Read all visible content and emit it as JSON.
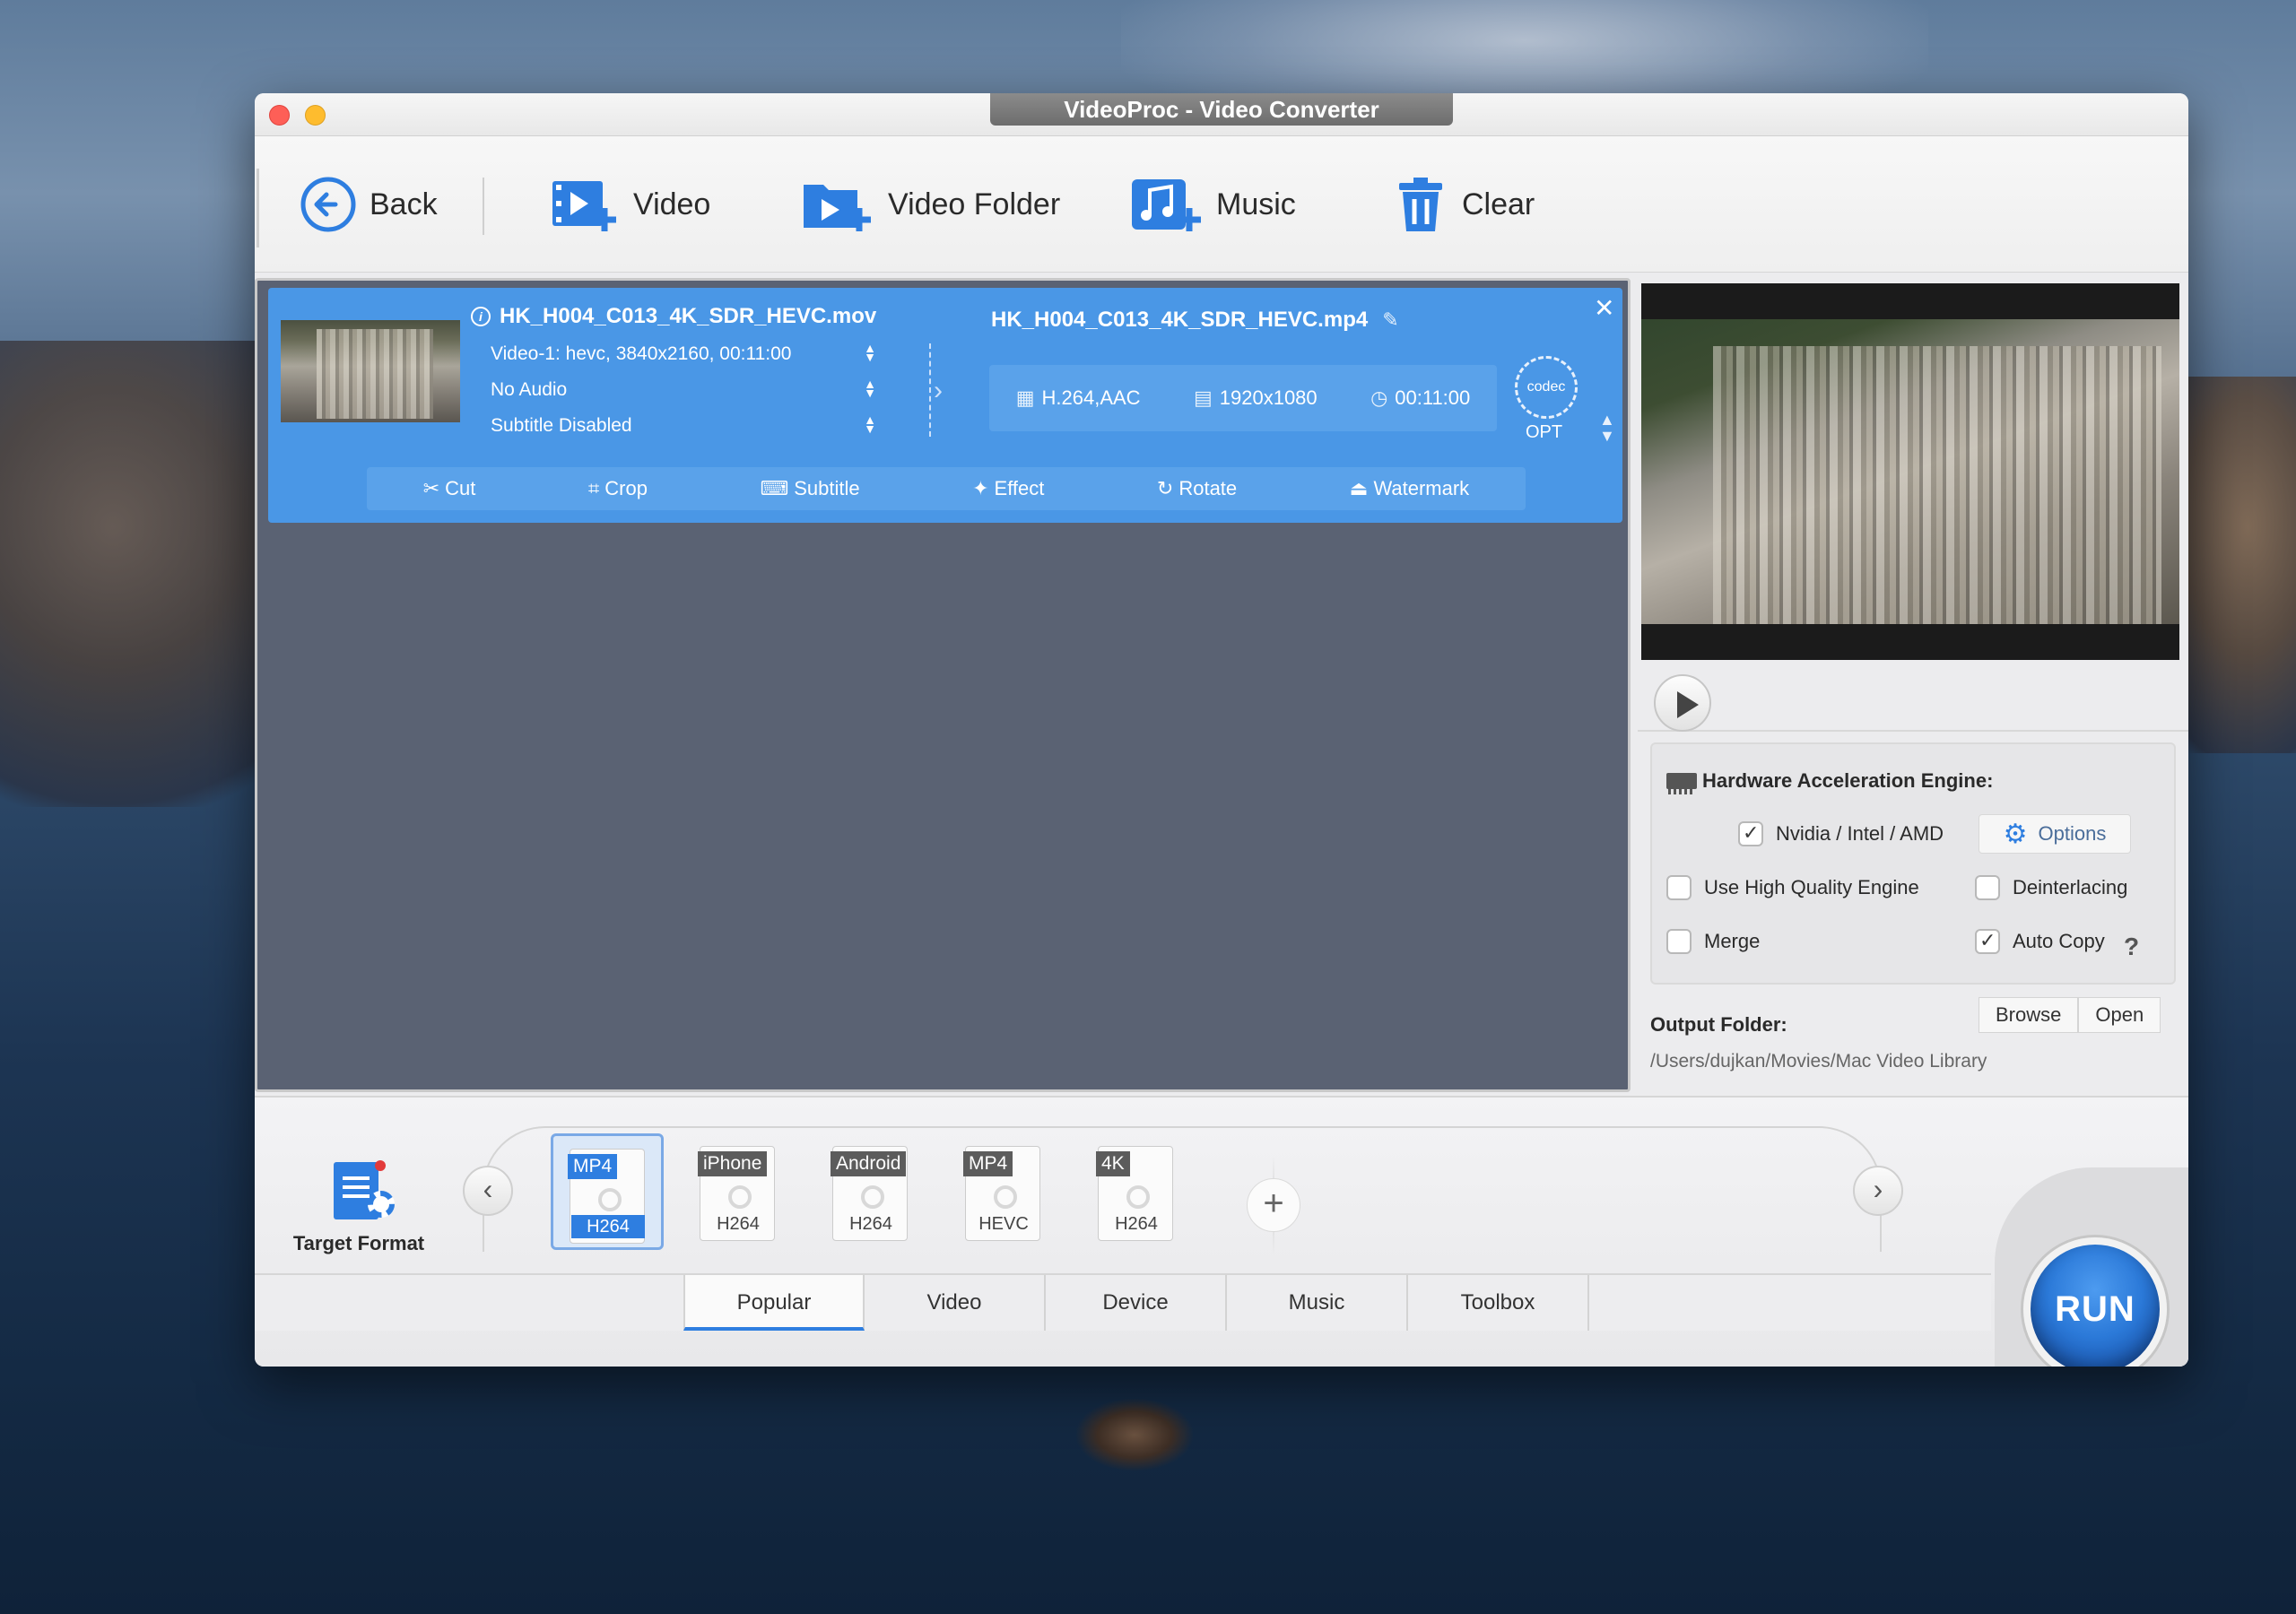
{
  "window": {
    "title": "VideoProc - Video Converter"
  },
  "toolbar": {
    "back": "Back",
    "video": "Video",
    "video_folder": "Video Folder",
    "music": "Music",
    "clear": "Clear"
  },
  "file": {
    "source_name": "HK_H004_C013_4K_SDR_HEVC.mov",
    "video_track": "Video-1: hevc, 3840x2160, 00:11:00",
    "audio_track": "No Audio",
    "subtitle_track": "Subtitle Disabled",
    "output_name": "HK_H004_C013_4K_SDR_HEVC.mp4",
    "output_codec": "H.264,AAC",
    "output_resolution": "1920x1080",
    "output_duration": "00:11:00",
    "codec_label": "codec",
    "opt_label": "OPT"
  },
  "edit_tools": [
    "Cut",
    "Crop",
    "Subtitle",
    "Effect",
    "Rotate",
    "Watermark"
  ],
  "hardware": {
    "title": "Hardware Acceleration Engine:",
    "nvidia": {
      "label": "Nvidia / Intel / AMD",
      "checked": true
    },
    "options_label": "Options",
    "high_quality": {
      "label": "Use High Quality Engine",
      "checked": false
    },
    "deinterlacing": {
      "label": "Deinterlacing",
      "checked": false
    },
    "merge": {
      "label": "Merge",
      "checked": false
    },
    "auto_copy": {
      "label": "Auto Copy",
      "checked": true
    },
    "help": "?"
  },
  "output": {
    "label": "Output Folder:",
    "browse": "Browse",
    "open": "Open",
    "path": "/Users/dujkan/Movies/Mac Video Library"
  },
  "target_format": {
    "label": "Target Format"
  },
  "formats": [
    {
      "top": "MP4",
      "bottom": "H264",
      "selected": true
    },
    {
      "top": "iPhone",
      "bottom": "H264",
      "selected": false
    },
    {
      "top": "Android",
      "bottom": "H264",
      "selected": false
    },
    {
      "top": "MP4",
      "bottom": "HEVC",
      "selected": false
    },
    {
      "top": "4K",
      "bottom": "H264",
      "selected": false
    }
  ],
  "tabs": [
    {
      "label": "Popular",
      "active": true
    },
    {
      "label": "Video",
      "active": false
    },
    {
      "label": "Device",
      "active": false
    },
    {
      "label": "Music",
      "active": false
    },
    {
      "label": "Toolbox",
      "active": false
    }
  ],
  "run_label": "RUN",
  "colors": {
    "accent": "#2e7ee0",
    "card": "#4a97e6"
  }
}
